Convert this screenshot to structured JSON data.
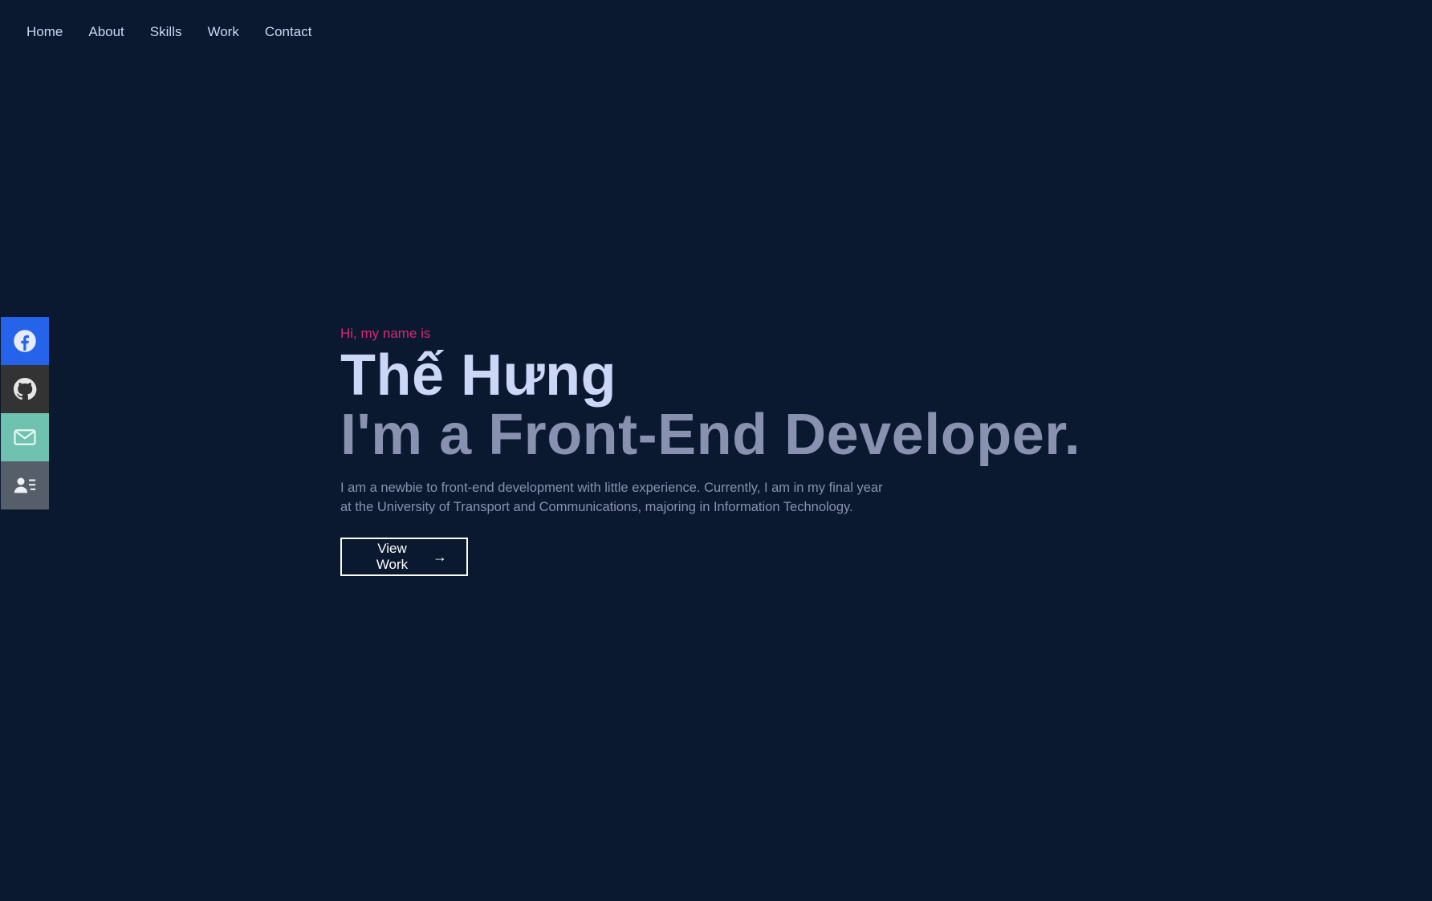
{
  "nav": {
    "items": [
      {
        "label": "Home"
      },
      {
        "label": "About"
      },
      {
        "label": "Skills"
      },
      {
        "label": "Work"
      },
      {
        "label": "Contact"
      }
    ]
  },
  "social": [
    {
      "icon": "facebook-icon",
      "color": "#2563eb"
    },
    {
      "icon": "github-icon",
      "color": "#333333"
    },
    {
      "icon": "mail-icon",
      "color": "#6fc2b0"
    },
    {
      "icon": "contact-card-icon",
      "color": "#565f69"
    }
  ],
  "hero": {
    "greeting": "Hi, my name is",
    "name": "Thế Hưng",
    "role": "I'm a Front-End Developer.",
    "intro_line1": "I am a newbie to front-end development with little experience. Currently, I am in my final year",
    "intro_line2": "at the University of Transport and Communications, majoring in Information Technology.",
    "button_label": "View Work",
    "button_icon": "arrow-right-icon"
  },
  "colors": {
    "background": "#0a192f",
    "accent": "#db2777",
    "heading": "#ccd6f6",
    "muted": "#8892b0"
  }
}
